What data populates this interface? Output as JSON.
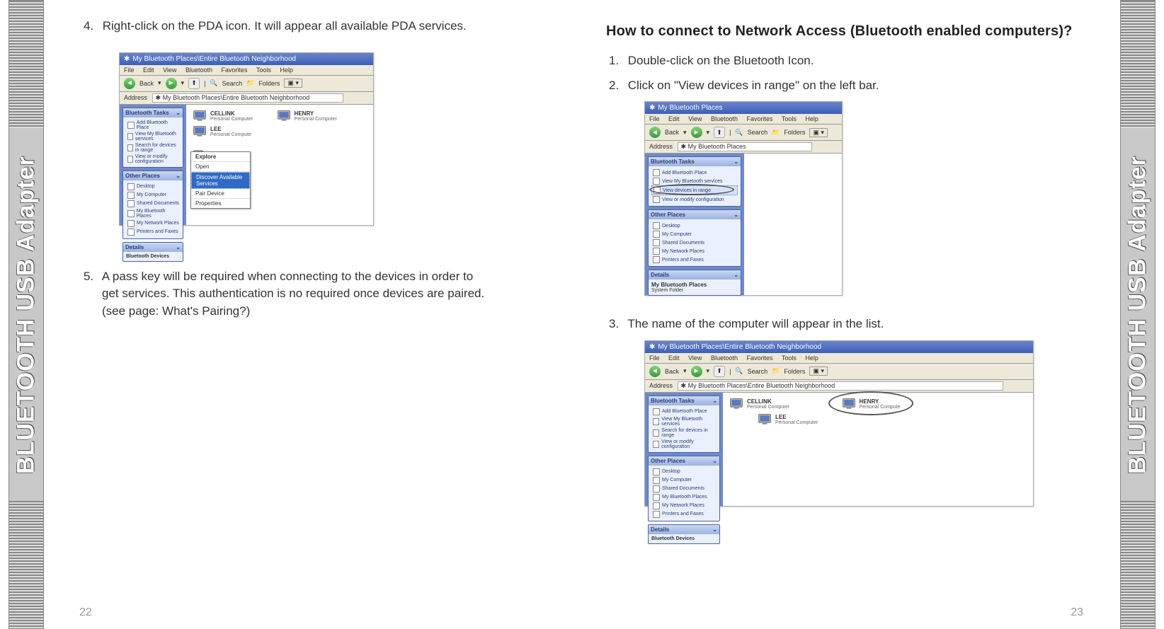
{
  "spine": {
    "label": "BLUETOOTH USB Adapter"
  },
  "left_page": {
    "number": "22",
    "step4": {
      "num": "4.",
      "text": "Right-click on the PDA icon. It will appear all available PDA services."
    },
    "step5": {
      "num": "5.",
      "line1": "A pass key will be required when connecting to the devices in order to",
      "line2": "get services. This authentication is no required once devices are paired.",
      "line3": "(see page: What's Pairing?)"
    },
    "screenshot1": {
      "title": "My Bluetooth Places\\Entire Bluetooth Neighborhood",
      "menus": [
        "File",
        "Edit",
        "View",
        "Bluetooth",
        "Favorites",
        "Tools",
        "Help"
      ],
      "toolbar": {
        "back": "Back",
        "search": "Search",
        "folders": "Folders"
      },
      "address_label": "Address",
      "address": "My Bluetooth Places\\Entire Bluetooth Neighborhood",
      "tasks_title": "Bluetooth Tasks",
      "tasks": [
        "Add Bluetooth Place",
        "View My Bluetooth services",
        "Search for devices in range",
        "View or modify configuration"
      ],
      "other_title": "Other Places",
      "other": [
        "Desktop",
        "My Computer",
        "Shared Documents",
        "My Bluetooth Places",
        "My Network Places",
        "Printers and Faxes"
      ],
      "details_title": "Details",
      "details_text": "Bluetooth Devices",
      "devices": [
        {
          "name": "CELLINK",
          "sub": "Personal Computer"
        },
        {
          "name": "HENRY",
          "sub": "Personal Computer"
        },
        {
          "name": "LEE",
          "sub": "Personal Compute"
        }
      ],
      "pda_label": "",
      "ctx": [
        "Explore",
        "Open",
        "Discover Available Services",
        "Pair Device",
        "Properties"
      ]
    }
  },
  "right_page": {
    "number": "23",
    "heading": "How to connect to Network Access (Bluetooth enabled computers)?",
    "step1": {
      "num": "1.",
      "text": "Double-click on the Bluetooth Icon."
    },
    "step2": {
      "num": "2.",
      "text": "Click on \"View devices in range\" on the left bar."
    },
    "step3": {
      "num": "3.",
      "text": "The name of the computer will appear in the list."
    },
    "screenshot2": {
      "title": "My Bluetooth Places",
      "menus": [
        "File",
        "Edit",
        "View",
        "Bluetooth",
        "Favorites",
        "Tools",
        "Help"
      ],
      "toolbar": {
        "back": "Back",
        "search": "Search",
        "folders": "Folders"
      },
      "address_label": "Address",
      "address": "My Bluetooth Places",
      "tasks_title": "Bluetooth Tasks",
      "tasks": [
        "Add Bluetooth Place",
        "View My Bluetooth services",
        "View devices in range",
        "View or modify configuration"
      ],
      "other_title": "Other Places",
      "other": [
        "Desktop",
        "My Computer",
        "Shared Documents",
        "My Network Places",
        "Printers and Faxes"
      ],
      "details_title": "Details",
      "details_line1": "My Bluetooth Places",
      "details_line2": "System Folder"
    },
    "screenshot3": {
      "title": "My Bluetooth Places\\Entire Bluetooth Neighborhood",
      "menus": [
        "File",
        "Edit",
        "View",
        "Bluetooth",
        "Favorites",
        "Tools",
        "Help"
      ],
      "toolbar": {
        "back": "Back",
        "search": "Search",
        "folders": "Folders"
      },
      "address_label": "Address",
      "address": "My Bluetooth Places\\Entire Bluetooth Neighborhood",
      "tasks_title": "Bluetooth Tasks",
      "tasks": [
        "Add Bluetooth Place",
        "View My Bluetooth services",
        "Search for devices in range",
        "View or modify configuration"
      ],
      "other_title": "Other Places",
      "other": [
        "Desktop",
        "My Computer",
        "Shared Documents",
        "My Bluetooth Places",
        "My Network Places",
        "Printers and Faxes"
      ],
      "details_title": "Details",
      "details_text": "Bluetooth Devices",
      "devices": [
        {
          "name": "CELLINK",
          "sub": "Personal Computer"
        },
        {
          "name": "HENRY",
          "sub": "Personal Compute"
        },
        {
          "name": "LEE",
          "sub": "Personal Computer"
        }
      ]
    }
  }
}
